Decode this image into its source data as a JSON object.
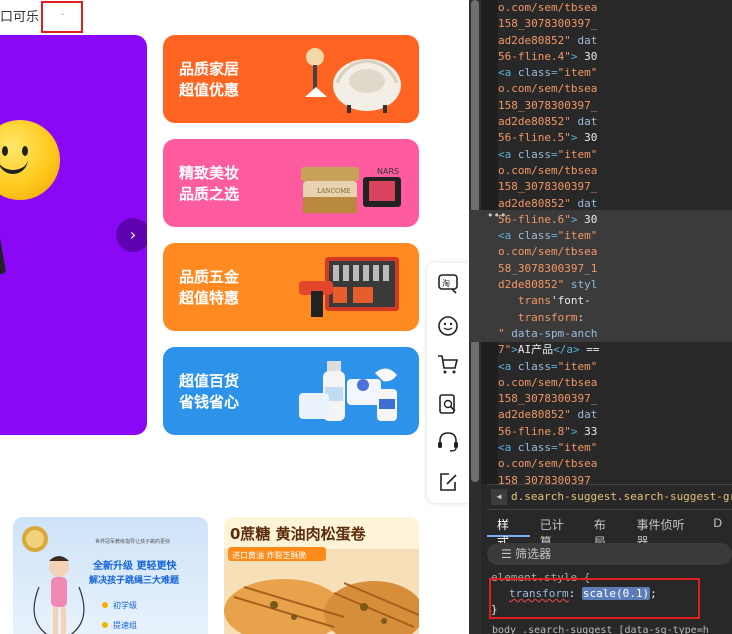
{
  "page": {
    "top_text": "口可乐",
    "red_box_text": "-",
    "hero_next_glyph": "›",
    "promos": [
      {
        "line1": "品质家居",
        "line2": "超值优惠",
        "color": "#ff6422"
      },
      {
        "line1": "精致美妆",
        "line2": "品质之选",
        "color": "#ff5ca0"
      },
      {
        "line1": "品质五金",
        "line2": "超值特惠",
        "color": "#ff8a22"
      },
      {
        "line1": "超值百货",
        "line2": "省钱省心",
        "color": "#2d93ea"
      }
    ],
    "side_tools": [
      "tmall-icon",
      "smile-icon",
      "cart-icon",
      "search-doc-icon",
      "headset-icon",
      "edit-icon"
    ],
    "cards": [
      {
        "headline": "全新升级 更轻更快",
        "sub": "解决孩子跳绳三大难题",
        "items": [
          "初学级",
          "提速组"
        ],
        "top_note": "世界冠军教练指导让孩子跳的更快"
      },
      {
        "headline": "0蔗糖 黄油肉松蛋卷",
        "sub": "进口黄油 炸裂芝酥脆"
      }
    ]
  },
  "devtools": {
    "code_lines": [
      {
        "parts": [
          [
            "c-val",
            "o.com/sem/tbsea"
          ]
        ]
      },
      {
        "parts": [
          [
            "c-val",
            "158_3078300397_"
          ]
        ]
      },
      {
        "parts": [
          [
            "c-val",
            "ad2de80852\""
          ],
          [
            "c-attr",
            " dat"
          ]
        ]
      },
      {
        "parts": [
          [
            "c-val",
            "56-fline.4\""
          ],
          [
            "c-tag",
            ">"
          ],
          [
            "c-txt",
            " 30"
          ]
        ]
      },
      {
        "parts": [
          [
            "c-tag",
            "<a "
          ],
          [
            "c-attr",
            "class"
          ],
          [
            "c-tag",
            "="
          ],
          [
            "c-val",
            "\"item\""
          ]
        ]
      },
      {
        "parts": [
          [
            "c-val",
            "o.com/sem/tbsea"
          ]
        ]
      },
      {
        "parts": [
          [
            "c-val",
            "158_3078300397_"
          ]
        ]
      },
      {
        "parts": [
          [
            "c-val",
            "ad2de80852\""
          ],
          [
            "c-attr",
            " dat"
          ]
        ]
      },
      {
        "parts": [
          [
            "c-val",
            "56-fline.5\""
          ],
          [
            "c-tag",
            ">"
          ],
          [
            "c-txt",
            " 30"
          ]
        ]
      },
      {
        "parts": [
          [
            "c-tag",
            "<a "
          ],
          [
            "c-attr",
            "class"
          ],
          [
            "c-tag",
            "="
          ],
          [
            "c-val",
            "\"item\""
          ]
        ]
      },
      {
        "parts": [
          [
            "c-val",
            "o.com/sem/tbsea"
          ]
        ]
      },
      {
        "parts": [
          [
            "c-val",
            "158_3078300397_"
          ]
        ]
      },
      {
        "parts": [
          [
            "c-val",
            "ad2de80852\""
          ],
          [
            "c-attr",
            " dat"
          ]
        ]
      },
      {
        "parts": [
          [
            "c-val",
            "56-fline.6\""
          ],
          [
            "c-tag",
            ">"
          ],
          [
            "c-txt",
            " 30"
          ]
        ]
      },
      {
        "parts": [
          [
            "c-tag",
            "<a "
          ],
          [
            "c-attr",
            "class"
          ],
          [
            "c-tag",
            "="
          ],
          [
            "c-val",
            "\"item\""
          ]
        ]
      },
      {
        "parts": [
          [
            "c-val",
            "o.com/sem/tbsea"
          ]
        ]
      },
      {
        "parts": [
          [
            "c-val",
            "58_3078300397_1"
          ]
        ]
      },
      {
        "parts": [
          [
            "c-val",
            "d2de80852\""
          ],
          [
            "c-attr",
            " styl"
          ]
        ]
      },
      {
        "parts": [
          [
            "c-prop",
            "   trans"
          ],
          [
            "c-txt",
            "'font-"
          ]
        ]
      },
      {
        "parts": [
          [
            "c-prop",
            "   transform"
          ],
          [
            "c-txt",
            ": "
          ]
        ]
      },
      {
        "parts": [
          [
            "c-val",
            "\""
          ],
          [
            "c-attr",
            " data-spm-anch"
          ]
        ]
      },
      {
        "parts": [
          [
            "c-val",
            "7\""
          ],
          [
            "c-tag",
            ">"
          ],
          [
            "c-txt",
            "AI产品"
          ],
          [
            "c-tag",
            "</a>"
          ],
          [
            "c-txt",
            " =="
          ]
        ]
      },
      {
        "parts": [
          [
            "c-tag",
            "<a "
          ],
          [
            "c-attr",
            "class"
          ],
          [
            "c-tag",
            "="
          ],
          [
            "c-val",
            "\"item\""
          ]
        ]
      },
      {
        "parts": [
          [
            "c-val",
            "o.com/sem/tbsea"
          ]
        ]
      },
      {
        "parts": [
          [
            "c-val",
            "158_3078300397_"
          ]
        ]
      },
      {
        "parts": [
          [
            "c-val",
            "ad2de80852\""
          ],
          [
            "c-attr",
            " dat"
          ]
        ]
      },
      {
        "parts": [
          [
            "c-val",
            "56-fline.8\""
          ],
          [
            "c-tag",
            ">"
          ],
          [
            "c-txt",
            " 33"
          ]
        ]
      },
      {
        "parts": [
          [
            "c-tag",
            "<a "
          ],
          [
            "c-attr",
            "class"
          ],
          [
            "c-tag",
            "="
          ],
          [
            "c-val",
            "\"item\""
          ]
        ]
      },
      {
        "parts": [
          [
            "c-val",
            "o.com/sem/tbsea"
          ]
        ]
      },
      {
        "parts": [
          [
            "c-val",
            "158_3078300397_"
          ]
        ]
      },
      {
        "parts": [
          [
            "c-val",
            "ad2de80852\""
          ],
          [
            "c-attr",
            " dat"
          ]
        ]
      }
    ],
    "ellipsis": "•••",
    "breadcrumb": "d.search-suggest.search-suggest-group",
    "breadcrumb_arrow": "◀",
    "tabs": [
      "样式",
      "已计算",
      "布局",
      "事件侦听器",
      "D"
    ],
    "filter_label": "筛选器",
    "filter_icon": "filter-icon",
    "style_selector": "element.style {",
    "style_prop": "transform",
    "style_value": "scale(0.1)",
    "style_close": "}",
    "bottom_line": "body .search-suggest [data-sg-type=h"
  }
}
